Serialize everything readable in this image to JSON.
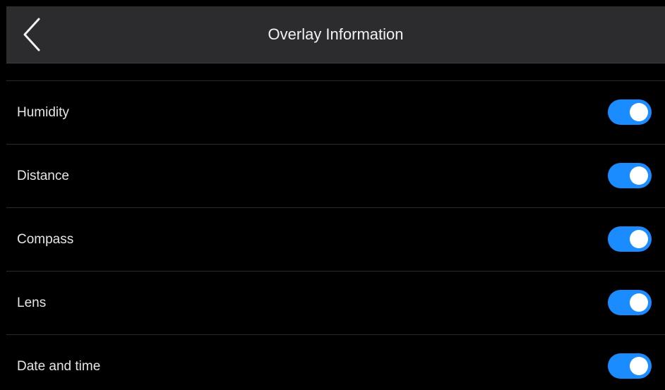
{
  "header": {
    "title": "Overlay Information",
    "back_icon": "chevron-left-icon"
  },
  "colors": {
    "header_bg": "#2c2c2e",
    "toggle_on": "#1a8cff",
    "knob": "#ffffff",
    "background": "#000000"
  },
  "settings": [
    {
      "label": "Humidity",
      "enabled": true
    },
    {
      "label": "Distance",
      "enabled": true
    },
    {
      "label": "Compass",
      "enabled": true
    },
    {
      "label": "Lens",
      "enabled": true
    },
    {
      "label": "Date and time",
      "enabled": true
    }
  ]
}
